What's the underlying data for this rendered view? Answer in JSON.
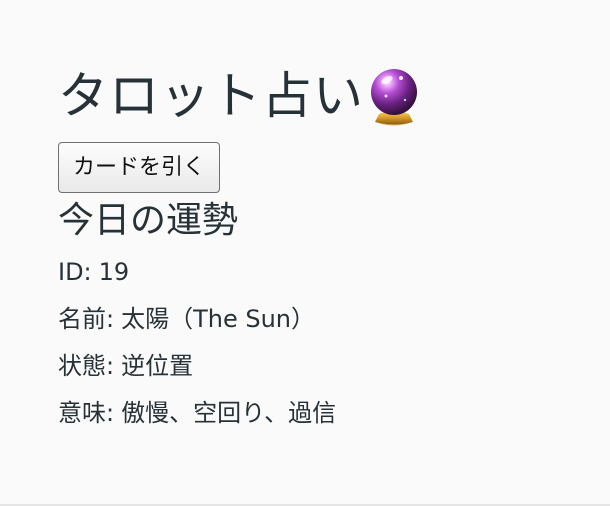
{
  "app": {
    "title": "タロット占い",
    "title_icon": "crystal-ball-icon"
  },
  "controls": {
    "draw_button_label": "カードを引く"
  },
  "fortune": {
    "heading": "今日の運勢",
    "id_label": "ID:",
    "id_value": "19",
    "name_label": "名前:",
    "name_value": "太陽（The Sun）",
    "state_label": "状態:",
    "state_value": "逆位置",
    "meaning_label": "意味:",
    "meaning_value": "傲慢、空回り、過信"
  },
  "colors": {
    "background": "#fafafa",
    "text": "#263238",
    "button_border": "#707070"
  }
}
